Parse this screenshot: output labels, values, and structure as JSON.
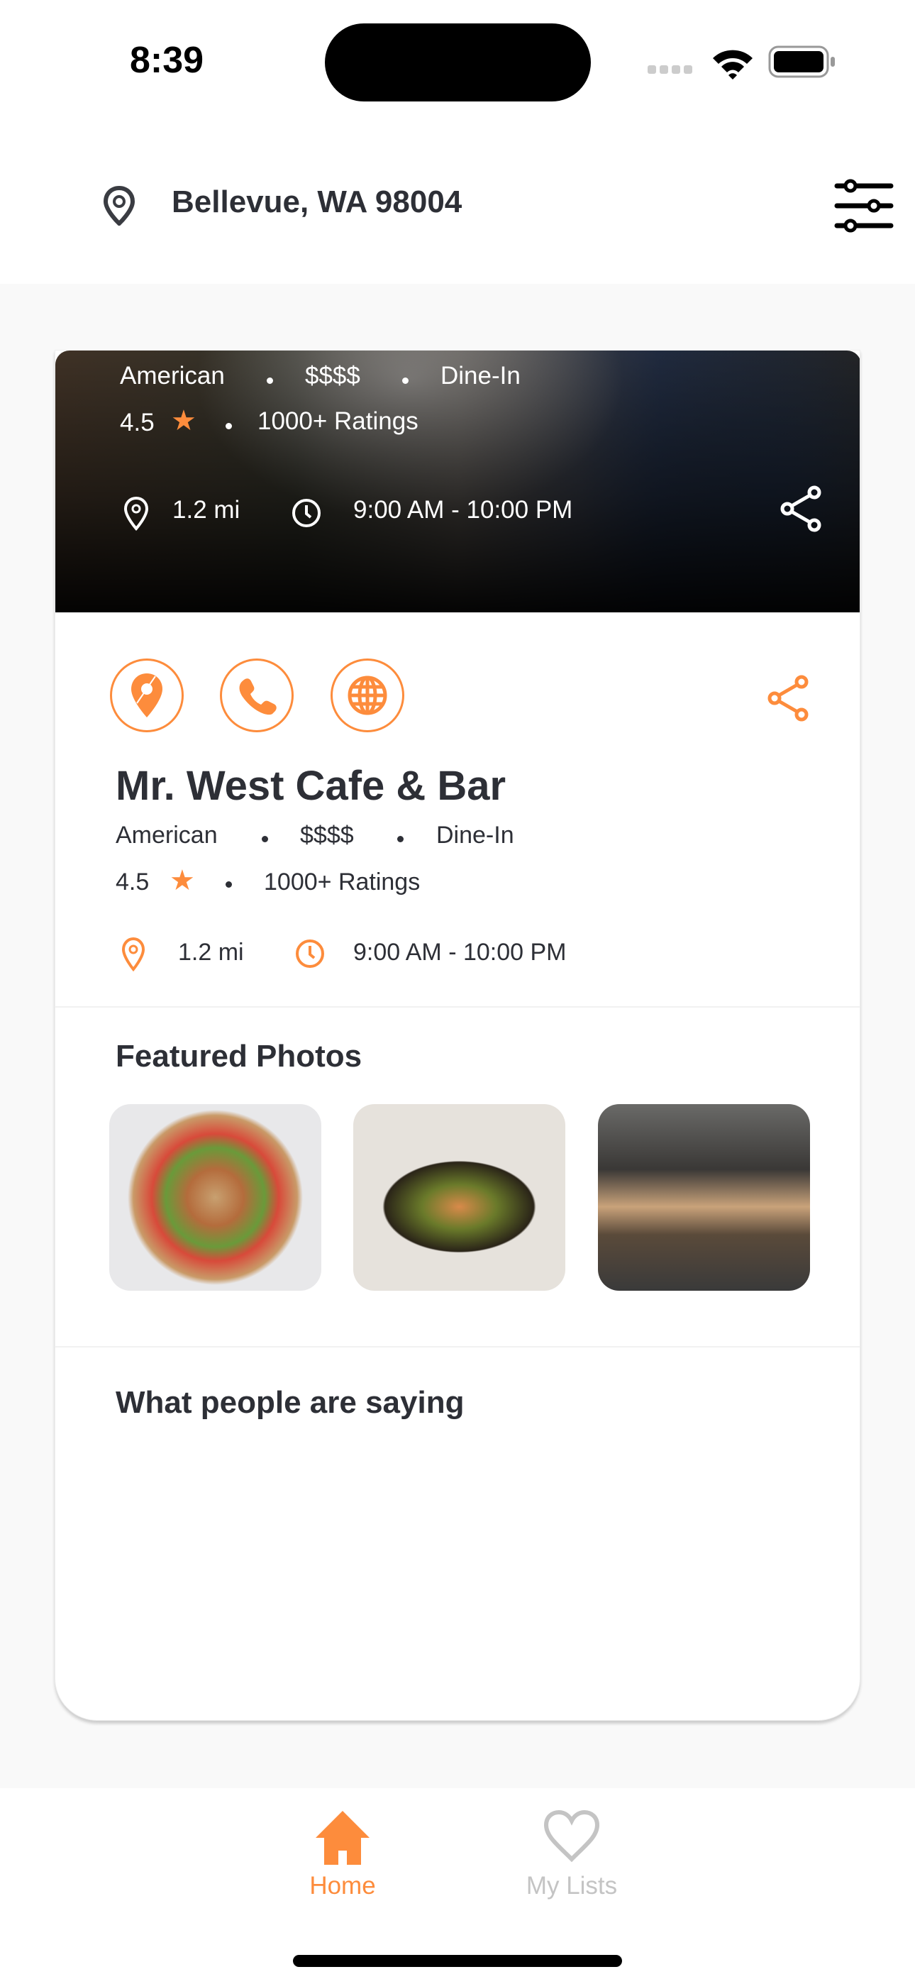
{
  "status_bar": {
    "time": "8:39"
  },
  "header": {
    "location": "Bellevue, WA 98004",
    "location_icon": "map-pin-icon",
    "filter_icon": "sliders-icon"
  },
  "restaurant": {
    "name": "Mr. West Cafe & Bar",
    "cuisine": "American",
    "price": "$$$$",
    "service": "Dine-In",
    "rating": "4.5",
    "ratings_count": "1000+ Ratings",
    "distance": "1.2 mi",
    "hours": "9:00 AM - 10:00 PM"
  },
  "actions": [
    {
      "icon": "map-icon"
    },
    {
      "icon": "phone-icon"
    },
    {
      "icon": "globe-icon"
    },
    {
      "icon": "share-icon"
    }
  ],
  "sections": {
    "featured_photos": "Featured Photos",
    "reviews": "What people are saying"
  },
  "photos": [
    {
      "subject": "salad-bowl"
    },
    {
      "subject": "salmon-dish"
    },
    {
      "subject": "cafe-interior"
    }
  ],
  "bottom_nav": [
    {
      "label": "Home",
      "icon": "home-icon",
      "active": true
    },
    {
      "label": "My Lists",
      "icon": "heart-icon",
      "active": false
    }
  ],
  "colors": {
    "accent": "#fd8c3c",
    "text": "#2d2f36",
    "inactive": "#c4c4c4"
  }
}
